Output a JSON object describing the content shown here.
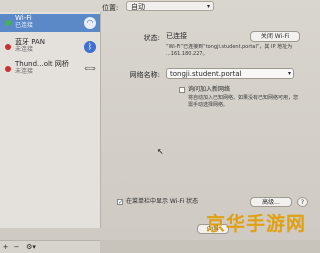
{
  "location": {
    "label": "位置:",
    "value": "自动"
  },
  "sidebar": {
    "items": [
      {
        "name": "Wi-Fi",
        "status": "已连接",
        "dot_color": "#3fb54a",
        "icon": "wifi-icon"
      },
      {
        "name": "蓝牙 PAN",
        "status": "未连接",
        "dot_color": "#cc2f2f",
        "icon": "bluetooth-icon"
      },
      {
        "name": "Thund...olt 网桥",
        "status": "未连接",
        "dot_color": "#cc2f2f",
        "icon": "thunderbolt-icon"
      }
    ],
    "footer": {
      "add": "+",
      "remove": "−",
      "actions": "⚙▾"
    }
  },
  "status": {
    "label": "状态:",
    "value": "已连接",
    "button": "关闭 Wi-Fi",
    "description": "“Wi-Fi”已连接到“tongji.student.portal”，其 IP 地址为 ...161.180.227。"
  },
  "network": {
    "label": "网络名称:",
    "value": "tongji.student.portal",
    "join_prompt": "询问加入新网络",
    "join_description": "将自动加入已知网络。如果没有已知网络可用，您需手动选择网络。"
  },
  "show_in_menubar": {
    "label": "在菜单栏中显示 Wi-Fi 状态",
    "checked": true
  },
  "buttons": {
    "advanced": "高级...",
    "help": "?",
    "revert": "向导"
  },
  "watermark": "京华手游网"
}
